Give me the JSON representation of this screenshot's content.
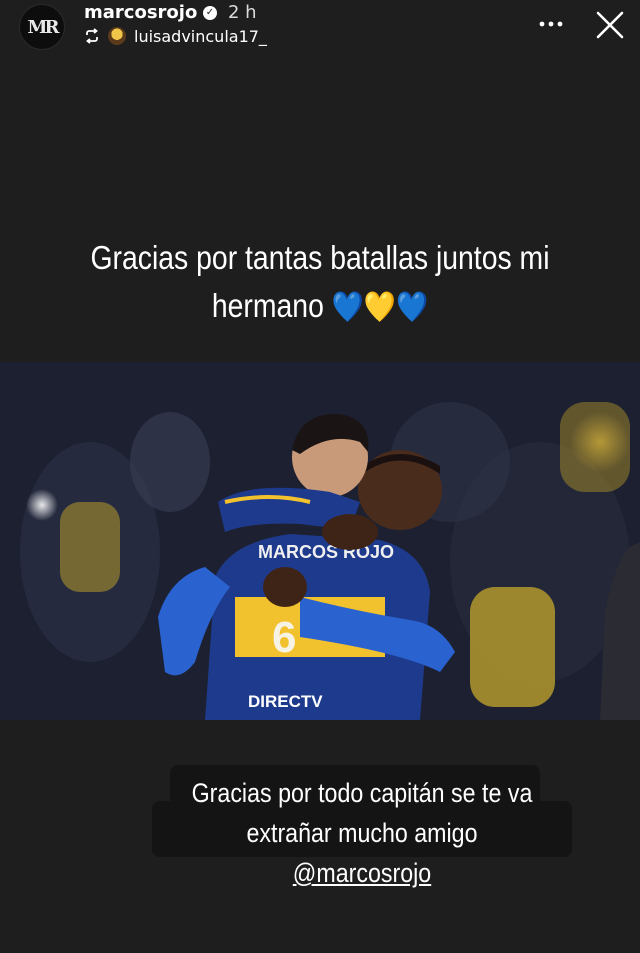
{
  "header": {
    "avatar_text": "MR",
    "username": "marcosrojo",
    "time": "2 h",
    "repost_user": "luisadvincula17_",
    "icons": [
      "repost-icon",
      "more-options-icon",
      "close-icon",
      "verified-badge-icon"
    ]
  },
  "caption": {
    "line1": "Gracias por tantas batallas juntos mi",
    "line2": "hermano",
    "hearts": "💙💛💙"
  },
  "photo": {
    "jersey_name": "MARCOS ROJO",
    "jersey_sponsor": "DIRECTV",
    "jersey_number": "6"
  },
  "sticker": {
    "line1": "Gracias por todo capitán se te va",
    "line2_prefix": "extrañar mucho amigo ",
    "mention": "@marcosrojo"
  },
  "colors": {
    "background": "#1e1e1e",
    "jersey_blue": "#1e3a8c",
    "jersey_gold": "#f2c12e"
  }
}
